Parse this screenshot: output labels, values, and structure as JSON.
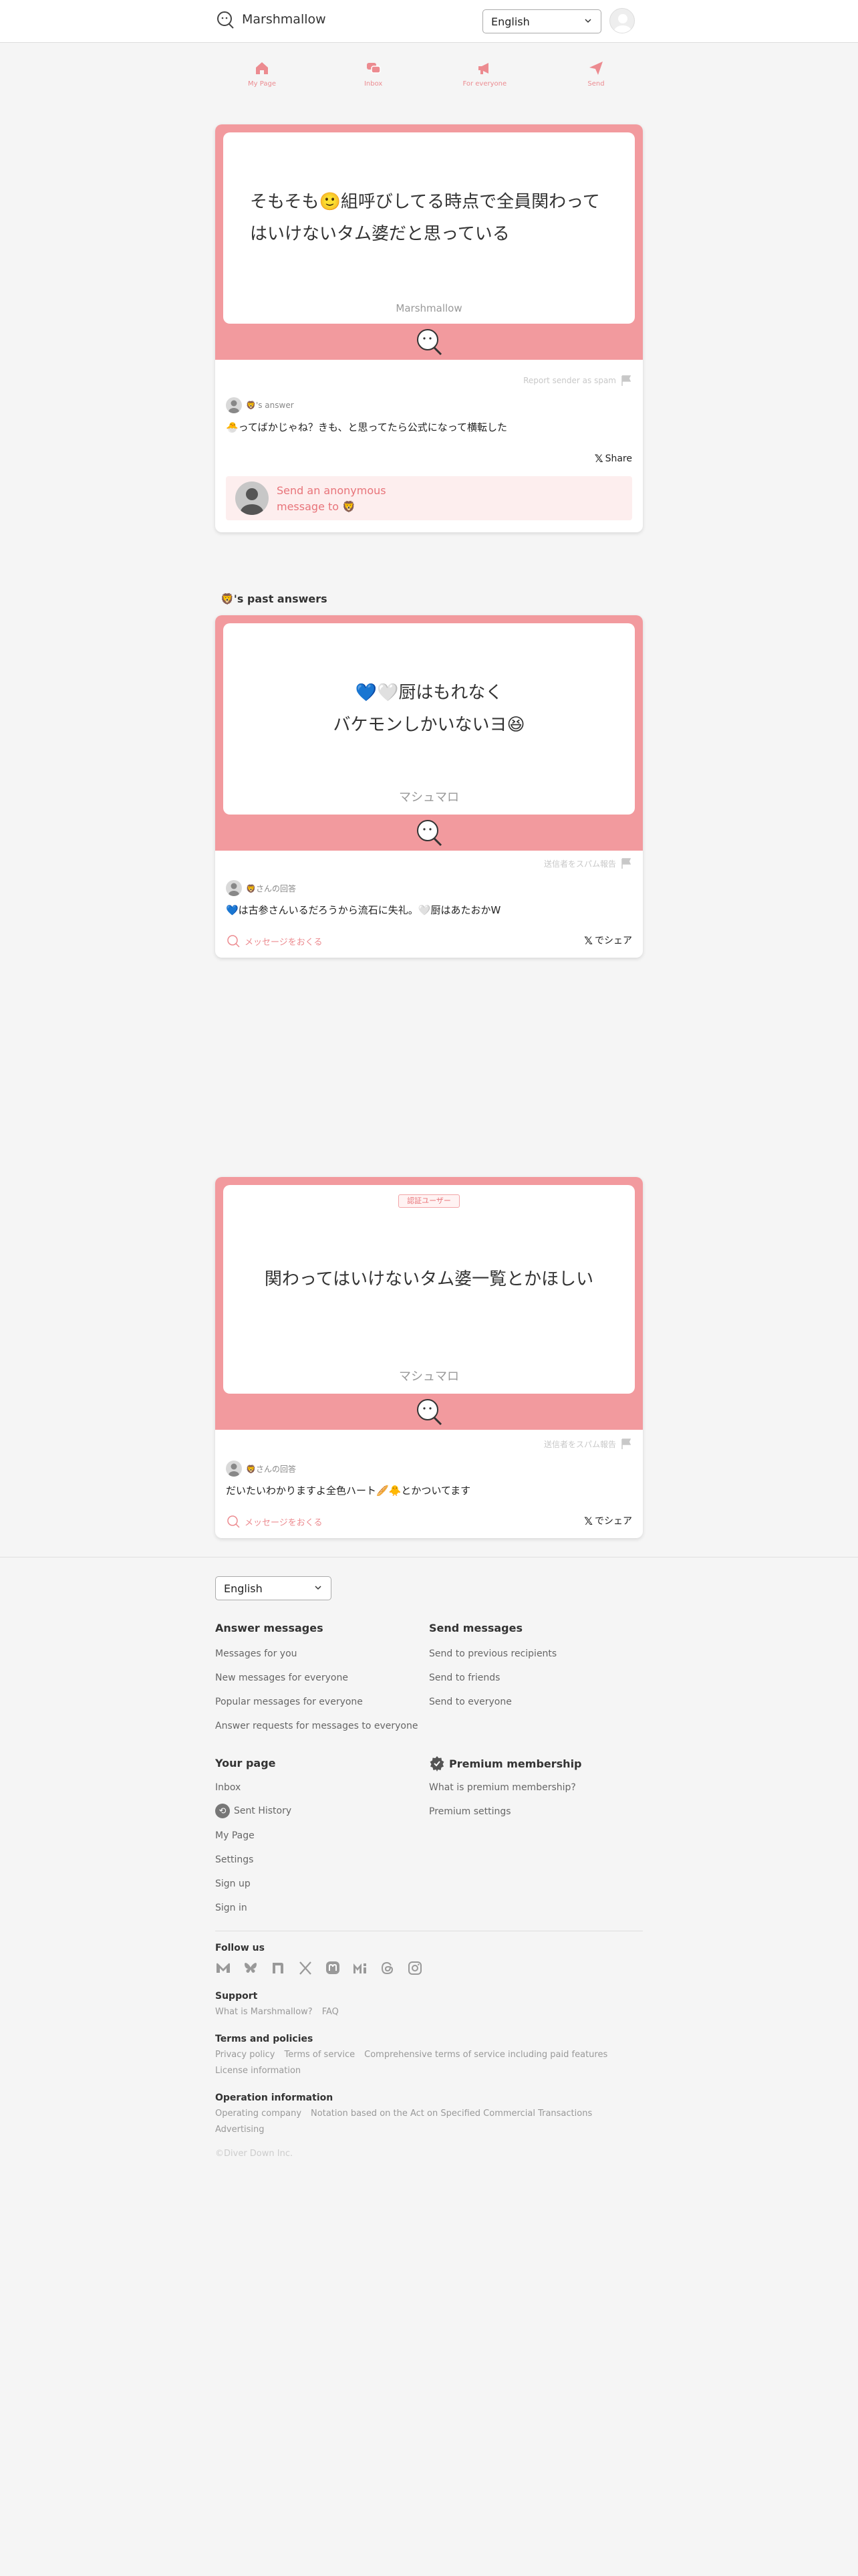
{
  "header": {
    "logo_text": "Marshmallow",
    "language": "English"
  },
  "nav": [
    {
      "label": "My Page",
      "icon": "home-icon"
    },
    {
      "label": "Inbox",
      "icon": "inbox-icon"
    },
    {
      "label": "For everyone",
      "icon": "megaphone-icon"
    },
    {
      "label": "Send",
      "icon": "send-icon"
    }
  ],
  "featured": {
    "message": "そもそも🙂組呼びしてる時点で全員関わってはいけないタム婆だと思っている",
    "brand": "Marshmallow",
    "report_label": "Report sender as spam",
    "answer_label": "🦁's answer",
    "answer_text": "🐣ってばかじゃね？きも、と思ってたら公式になって横転した",
    "share_label": "Share",
    "send_prompt": "Send an anonymous message to 🦁"
  },
  "past_answers_title": "🦁's past answers",
  "past": [
    {
      "message_line1": "💙🤍厨はもれなく",
      "message_line2": "バケモンしかいないヨ😆",
      "brand": "マシュマロ",
      "report_label": "送信者をスパム報告",
      "answer_label": "🦁さんの回答",
      "answer_text": "💙は古参さんいるだろうから流石に失礼。🤍厨はあたおかW",
      "open_label": "メッセージをおくる",
      "share_label": "でシェア"
    },
    {
      "badge": "認証ユーザー",
      "message": "関わってはいけないタム婆一覧とかほしい",
      "brand": "マシュマロ",
      "report_label": "送信者をスパム報告",
      "answer_label": "🦁さんの回答",
      "answer_text": "だいたいわかりますよ全色ハート🥖🐥とかついてます",
      "open_label": "メッセージをおくる",
      "share_label": "でシェア"
    }
  ],
  "footer": {
    "language": "English",
    "answer_title": "Answer messages",
    "answer_links": [
      "Messages for you",
      "New messages for everyone",
      "Popular messages for everyone",
      "Answer requests for messages to everyone"
    ],
    "send_title": "Send messages",
    "send_links": [
      "Send to previous recipients",
      "Send to friends",
      "Send to everyone"
    ],
    "page_title": "Your page",
    "page_links": [
      "Inbox",
      "Sent History",
      "My Page",
      "Settings",
      "Sign up",
      "Sign in"
    ],
    "premium_title": "Premium membership",
    "premium_links": [
      "What is premium membership?",
      "Premium settings"
    ],
    "follow_title": "Follow us",
    "social_icons": [
      "misskey-icon",
      "bluesky-icon",
      "note-icon",
      "x-icon",
      "mastodon-icon",
      "misskey-io-icon",
      "threads-icon",
      "instagram-icon"
    ],
    "support_title": "Support",
    "support_links": [
      "What is Marshmallow?",
      "FAQ"
    ],
    "terms_title": "Terms and policies",
    "terms_links": [
      "Privacy policy",
      "Terms of service",
      "Comprehensive terms of service including paid features"
    ],
    "license": "License information",
    "ops_title": "Operation information",
    "ops_links": [
      "Operating company",
      "Notation based on the Act on Specified Commercial Transactions"
    ],
    "advertising": "Advertising",
    "copyright": "©Diver Down Inc."
  },
  "colors": {
    "accent": "#f29a9e",
    "accent_text": "#ec8b90",
    "send_box": "#fdeeee"
  }
}
